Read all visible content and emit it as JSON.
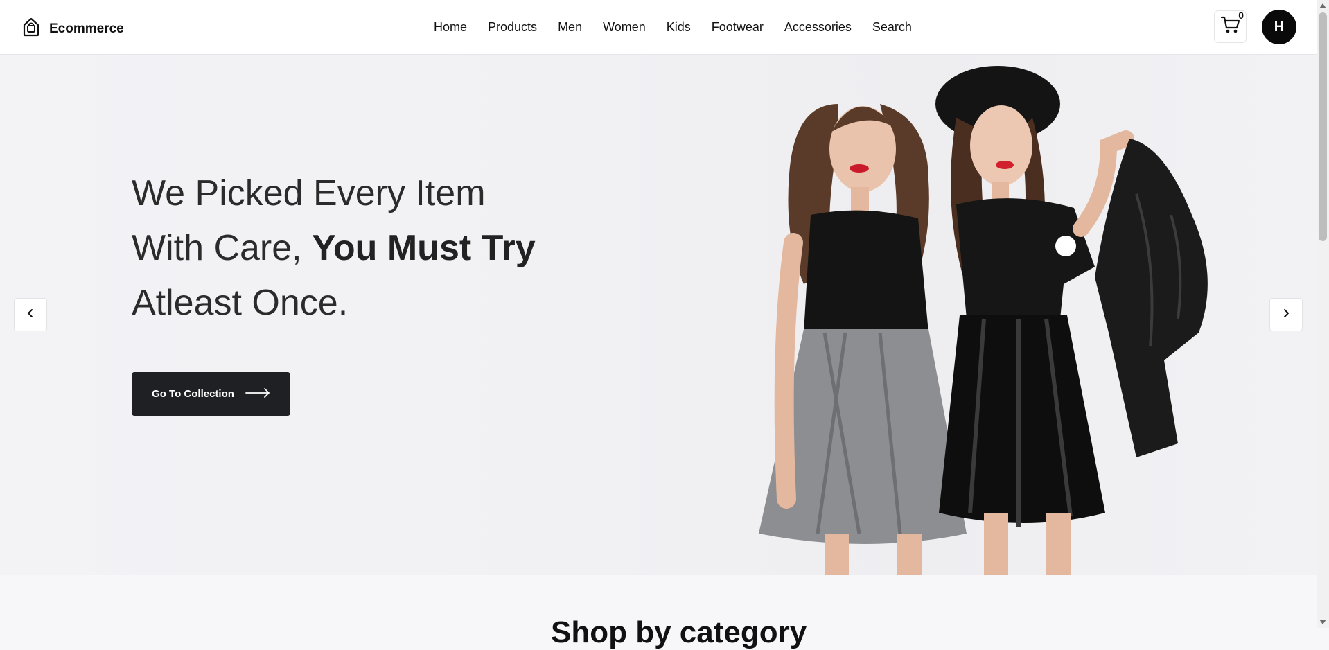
{
  "brand": {
    "name": "Ecommerce",
    "icon": "shopping-bag-icon"
  },
  "nav": [
    {
      "label": "Home"
    },
    {
      "label": "Products"
    },
    {
      "label": "Men"
    },
    {
      "label": "Women"
    },
    {
      "label": "Kids"
    },
    {
      "label": "Footwear"
    },
    {
      "label": "Accessories"
    },
    {
      "label": "Search"
    }
  ],
  "cart": {
    "count": "0",
    "icon": "cart-icon"
  },
  "user": {
    "initial": "H"
  },
  "hero": {
    "line1": "We Picked Every Item",
    "line2_regular": "With Care, ",
    "line2_bold": "You Must Try",
    "line3": "Atleast Once.",
    "cta_label": "Go To Collection",
    "prev_icon": "chevron-left-icon",
    "next_icon": "chevron-right-icon"
  },
  "section": {
    "title": "Shop by category"
  },
  "colors": {
    "button_dark": "#1f2023",
    "avatar_bg": "#0a0a0a"
  }
}
